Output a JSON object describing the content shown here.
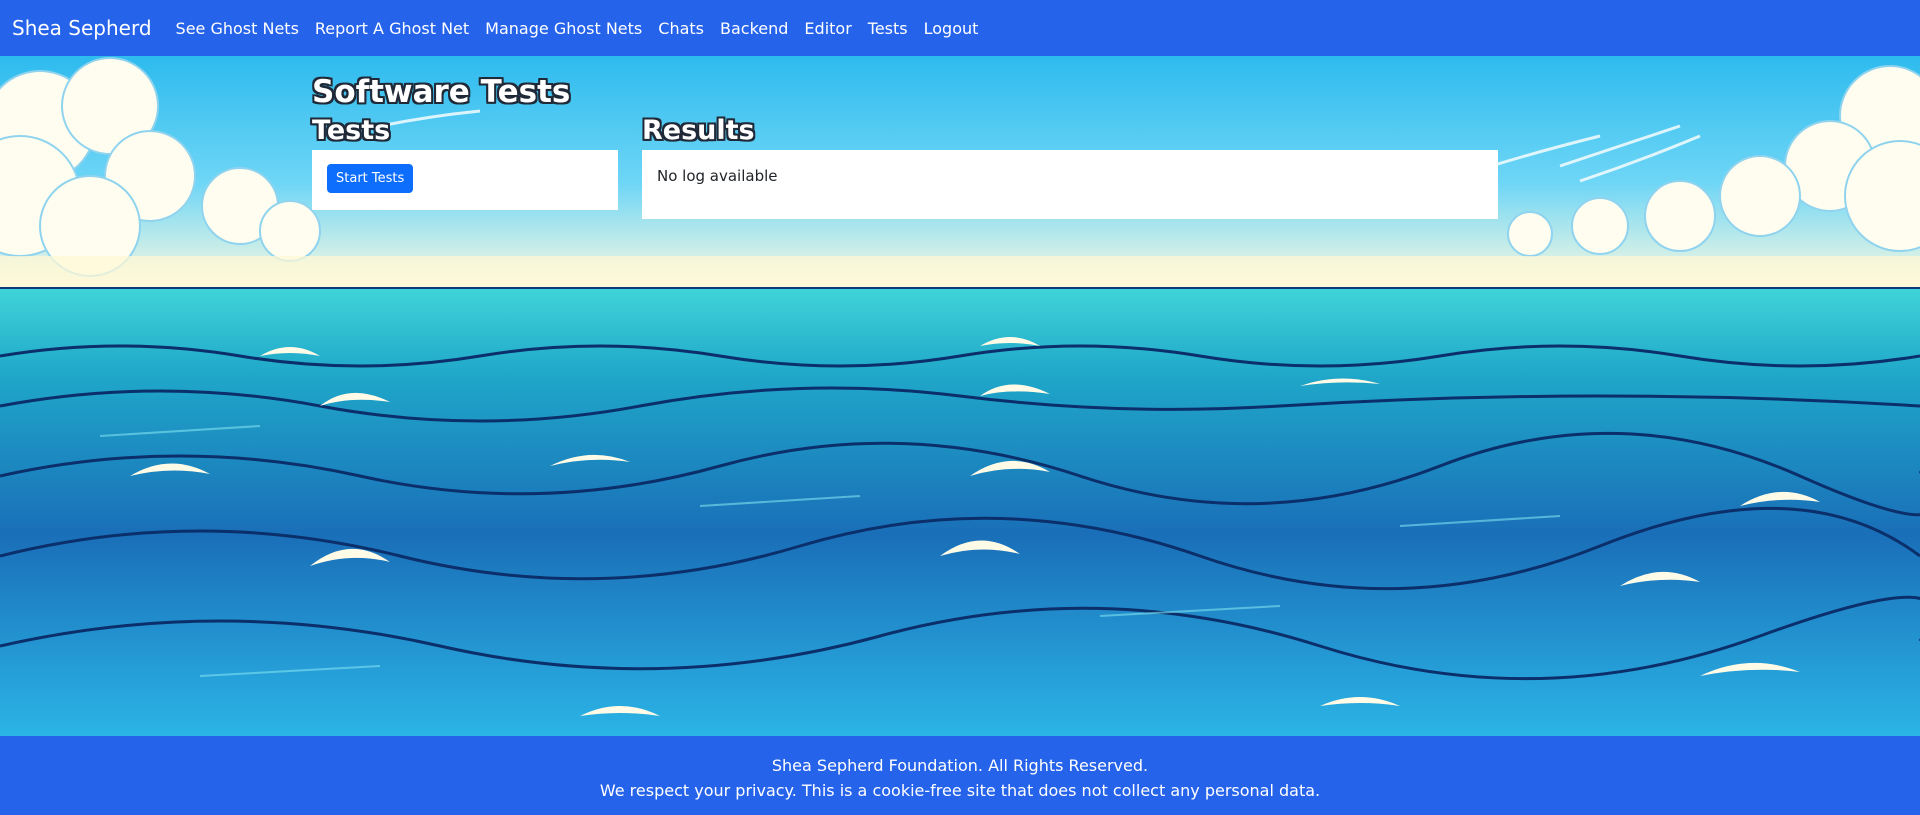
{
  "navbar": {
    "brand": "Shea Sepherd",
    "links": [
      {
        "label": "See Ghost Nets"
      },
      {
        "label": "Report A Ghost Net"
      },
      {
        "label": "Manage Ghost Nets"
      },
      {
        "label": "Chats"
      },
      {
        "label": "Backend"
      },
      {
        "label": "Editor"
      },
      {
        "label": "Tests"
      },
      {
        "label": "Logout"
      }
    ],
    "color": "#2563eb"
  },
  "main": {
    "title": "Software Tests",
    "tests": {
      "heading": "Tests",
      "start_button": "Start Tests"
    },
    "results": {
      "heading": "Results",
      "log": "No log available"
    }
  },
  "footer": {
    "line1": "Shea Sepherd Foundation. All Rights Reserved.",
    "line2": "We respect your privacy. This is a cookie-free site that does not collect any personal data."
  },
  "background": {
    "icon": "ocean-waves-illustration",
    "sky_color": "#39c4f0",
    "sea_color": "#1e78c8"
  }
}
